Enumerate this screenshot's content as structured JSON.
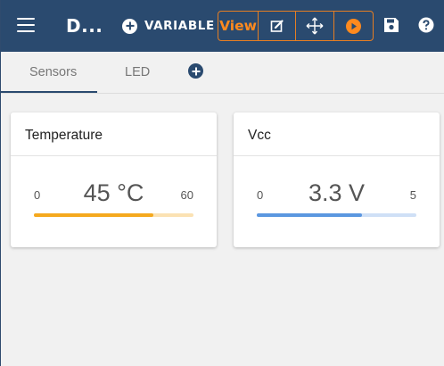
{
  "header": {
    "title": "D...",
    "add_variable_label": "VARIABLE",
    "mode_view_label": "View",
    "icons": {
      "menu": "menu-icon",
      "add": "plus-circle-icon",
      "edit": "edit-icon",
      "move": "move-icon",
      "run": "play-icon",
      "save": "save-icon",
      "help": "help-icon"
    },
    "colors": {
      "bar": "#2a4a6f",
      "accent": "#ff8a1e"
    }
  },
  "tabs": {
    "items": [
      {
        "label": "Sensors",
        "active": true
      },
      {
        "label": "LED",
        "active": false
      }
    ]
  },
  "widgets": [
    {
      "title": "Temperature",
      "value": "45 °C",
      "min": "0",
      "max": "60",
      "level": 0.75,
      "bar_color": "#f5a91e",
      "track_color": "#fbe2b3"
    },
    {
      "title": "Vcc",
      "value": "3.3 V",
      "min": "0",
      "max": "5",
      "level": 0.66,
      "bar_color": "#5b97e0",
      "track_color": "#cfe0f6"
    }
  ]
}
